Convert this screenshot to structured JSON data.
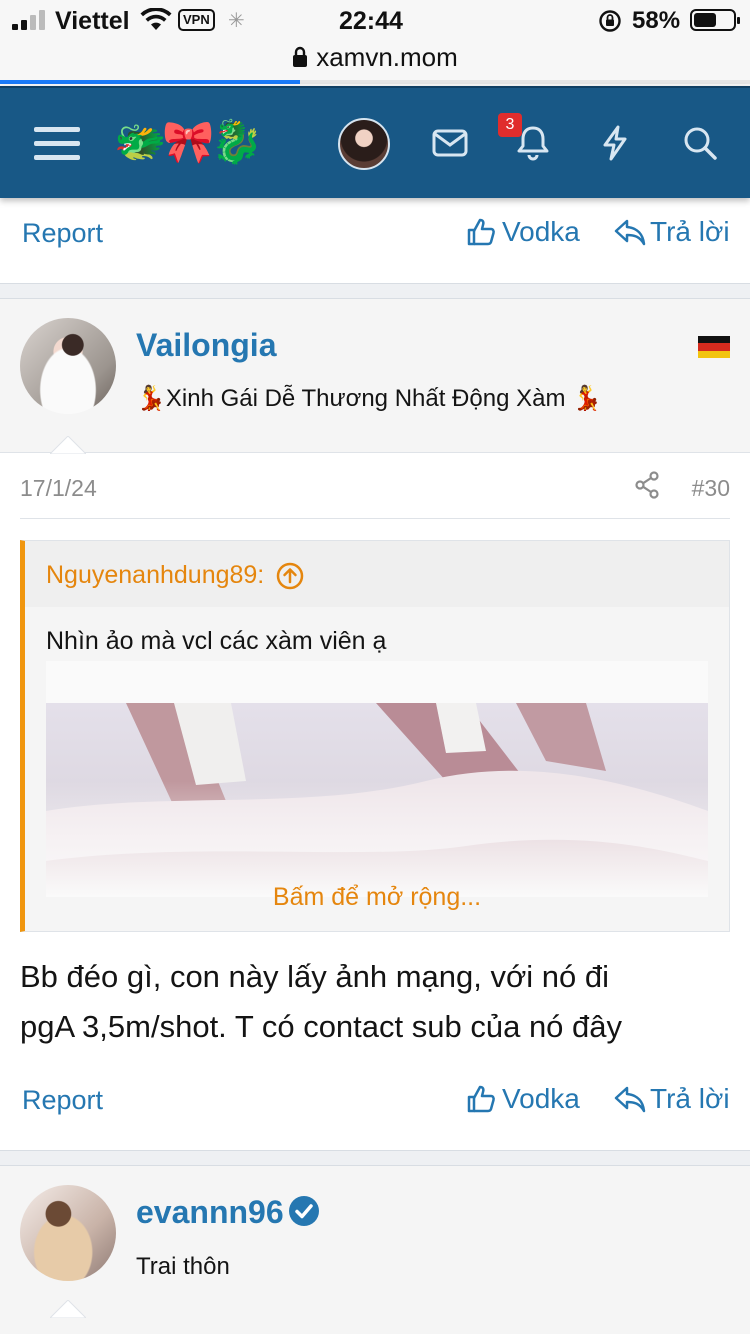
{
  "status_bar": {
    "carrier": "Viettel",
    "vpn": "VPN",
    "time": "22:44",
    "battery_percent": "58%",
    "battery_level": 0.58
  },
  "browser": {
    "url": "xamvn.mom",
    "load_progress": 0.4
  },
  "header": {
    "logo_text": "🐲🎀🐉",
    "notification_count": "3",
    "brand_color": "#185886"
  },
  "top_actions": {
    "report": "Report",
    "like": "Vodka",
    "reply": "Trả lời"
  },
  "post": {
    "author": "Vailongia",
    "user_title": "💃Xinh Gái Dễ Thương Nhất Động Xàm 💃",
    "flag": "germany",
    "date": "17/1/24",
    "number": "#30",
    "quote": {
      "author": "Nguyenanhdung89:",
      "text": "Nhìn ảo mà vcl các xàm viên ạ",
      "expand": "Bấm để mở rộng..."
    },
    "body_line1": "Bb đéo gì, con này lấy ảnh mạng, với nó đi",
    "body_line2": "pgA 3,5m/shot. T có contact sub của nó đây",
    "actions": {
      "report": "Report",
      "like": "Vodka",
      "reply": "Trả lời"
    }
  },
  "next_post": {
    "author": "evannn96",
    "user_title": "Trai thôn",
    "verified": true
  }
}
